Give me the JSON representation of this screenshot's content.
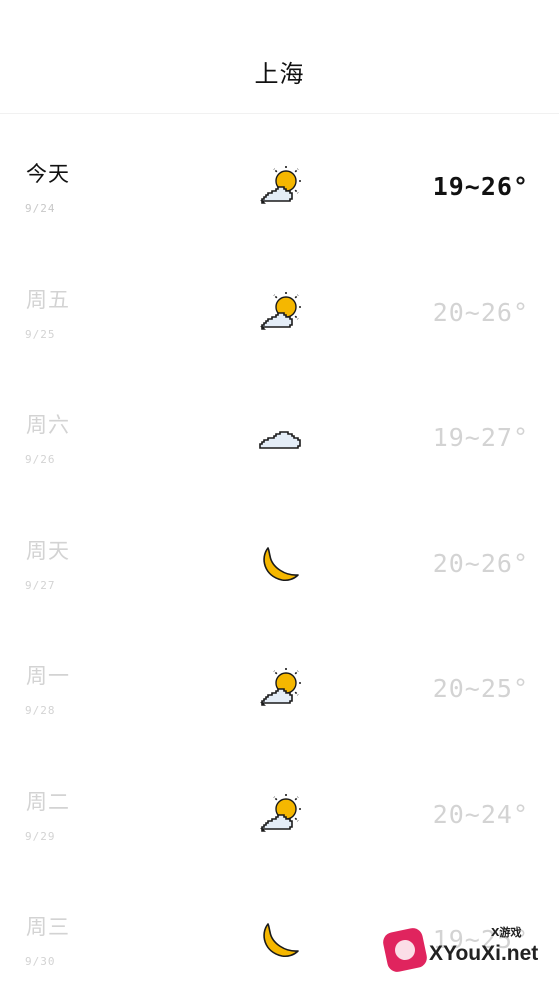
{
  "header": {
    "city": "上海"
  },
  "days": [
    {
      "name": "今天",
      "date": "9/24",
      "icon": "partly-cloudy-icon",
      "temp": "19~26°",
      "current": true
    },
    {
      "name": "周五",
      "date": "9/25",
      "icon": "partly-cloudy-icon",
      "temp": "20~26°",
      "current": false
    },
    {
      "name": "周六",
      "date": "9/26",
      "icon": "cloud-icon",
      "temp": "19~27°",
      "current": false
    },
    {
      "name": "周天",
      "date": "9/27",
      "icon": "moon-icon",
      "temp": "20~26°",
      "current": false
    },
    {
      "name": "周一",
      "date": "9/28",
      "icon": "partly-cloudy-icon",
      "temp": "20~25°",
      "current": false
    },
    {
      "name": "周二",
      "date": "9/29",
      "icon": "partly-cloudy-icon",
      "temp": "20~24°",
      "current": false
    },
    {
      "name": "周三",
      "date": "9/30",
      "icon": "moon-icon",
      "temp": "19~25°",
      "current": false
    }
  ],
  "watermark": {
    "brand": "XYouXi.net",
    "tag": "X游戏"
  },
  "colors": {
    "sun": "#f5b700",
    "cloud_fill": "#e4edf7",
    "outline": "#1a1a1a",
    "muted_text": "#d3d3d3"
  }
}
